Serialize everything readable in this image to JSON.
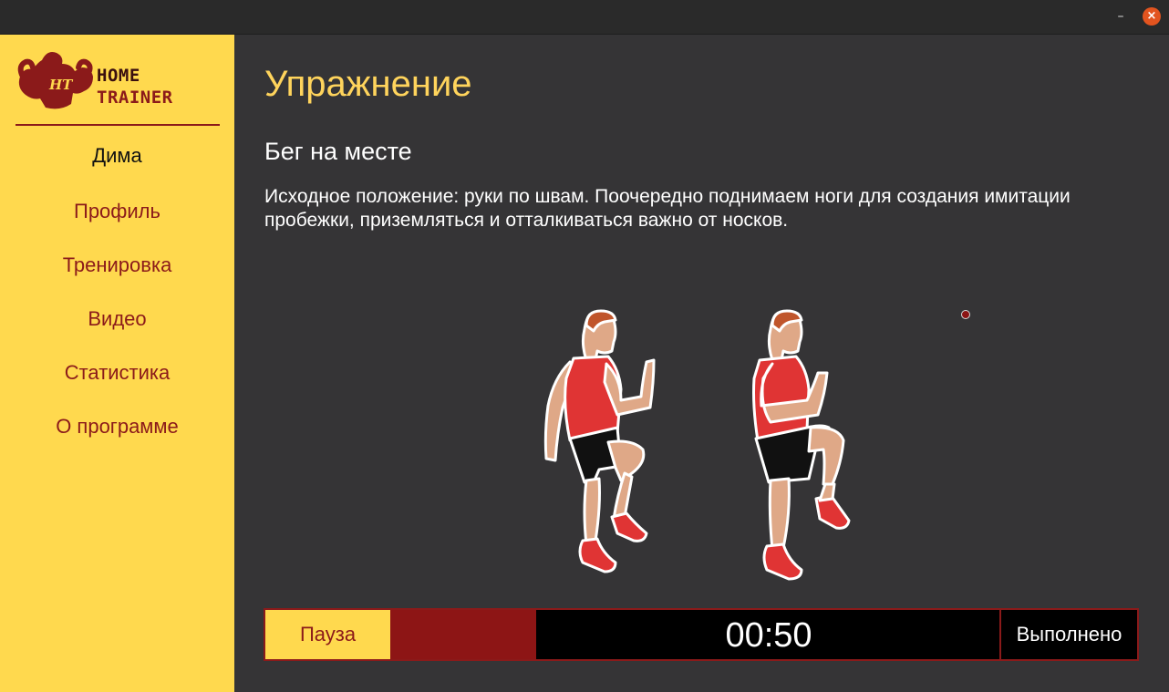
{
  "window": {
    "minimize_symbol": "–",
    "close_symbol": "×"
  },
  "logo": {
    "monogram": "HT",
    "line1": "HOME",
    "line2": "TRAINER"
  },
  "sidebar": {
    "user": "Дима",
    "items": [
      {
        "label": "Профиль"
      },
      {
        "label": "Тренировка"
      },
      {
        "label": "Видео"
      },
      {
        "label": "Статистика"
      },
      {
        "label": "О программе"
      }
    ]
  },
  "main": {
    "title": "Упражнение",
    "exercise_name": "Бег на месте",
    "description": "Исходное положение: руки по швам. Поочередно поднимаем ноги для создания имитации пробежки, приземляться и отталкиваться важно от носков."
  },
  "controls": {
    "pause_label": "Пауза",
    "timer": "00:50",
    "done_label": "Выполнено",
    "progress_fraction": 0.23
  },
  "colors": {
    "accent_yellow": "#ffd94e",
    "accent_red": "#8b1a1a",
    "background": "#353436",
    "title_yellow": "#ffd45c"
  }
}
